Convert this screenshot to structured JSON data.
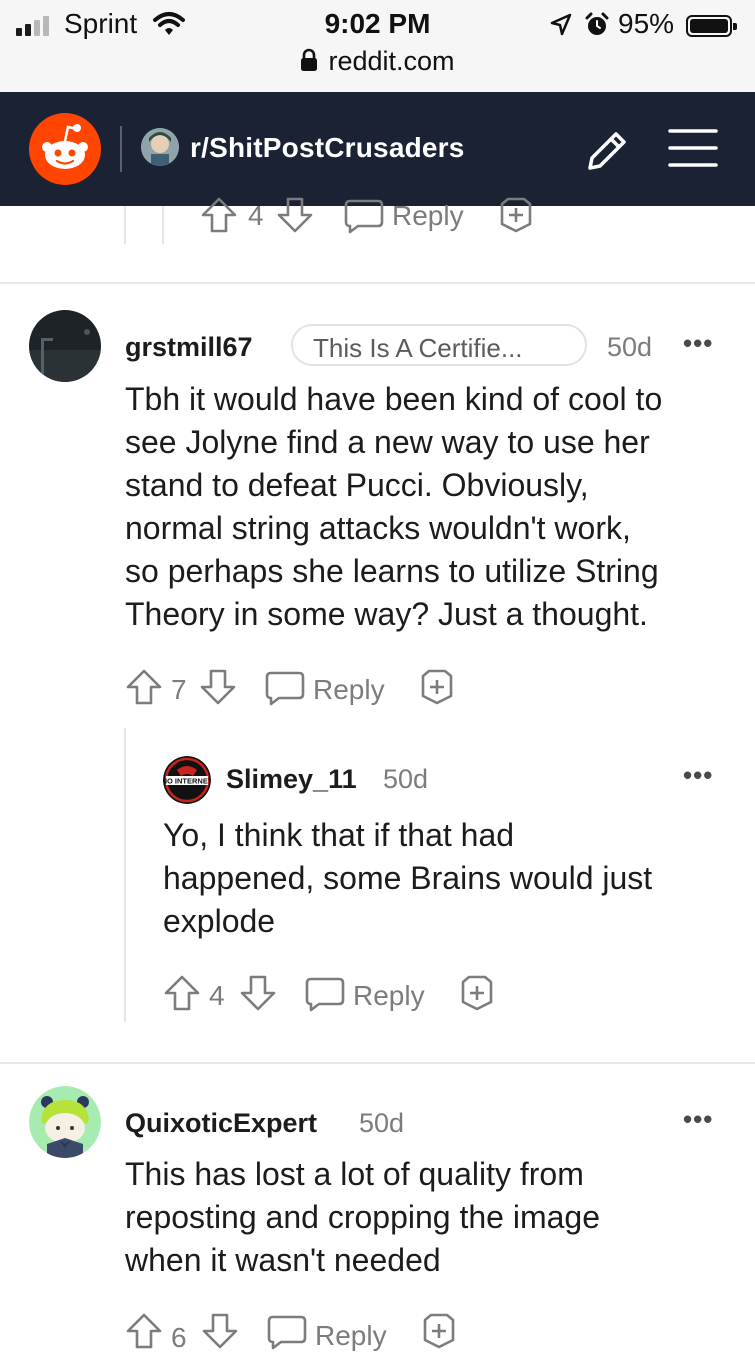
{
  "status_bar": {
    "carrier": "Sprint",
    "time": "9:02 PM",
    "battery": "95%",
    "url": "reddit.com"
  },
  "header": {
    "subreddit": "r/ShitPostCrusaders"
  },
  "top_actions": {
    "votes": "4",
    "reply_label": "Reply"
  },
  "comments": [
    {
      "author": "grstmill67",
      "flair": "This Is A Certifie...",
      "age": "50d",
      "body_lines": [
        "Tbh it would have been kind of cool to",
        "see Jolyne find a new way to use her",
        "stand to defeat Pucci. Obviously,",
        "normal string attacks wouldn't work,",
        "so perhaps she learns to utilize String",
        "Theory in some way? Just a thought."
      ],
      "votes": "7",
      "reply_label": "Reply"
    },
    {
      "author": "Slimey_11",
      "avatar_text": "NO INTERNET",
      "age": "50d",
      "body_lines": [
        "Yo, I think that if that had",
        "happened, some Brains would just",
        "explode"
      ],
      "votes": "4",
      "reply_label": "Reply"
    },
    {
      "author": "QuixoticExpert",
      "age": "50d",
      "body_lines": [
        "This has lost a lot of quality from",
        "reposting and cropping the image",
        "when it wasn't needed"
      ],
      "votes": "6",
      "reply_label": "Reply"
    }
  ],
  "icons": {
    "upvote": "arrow-up-outline",
    "downvote": "arrow-down-outline",
    "reply": "speech-bubble-outline",
    "award": "shield-plus-outline",
    "more": "ellipsis"
  },
  "colors": {
    "header_bg": "#1a2233",
    "brand": "#ff4500",
    "muted_text": "#7c7c7c"
  }
}
